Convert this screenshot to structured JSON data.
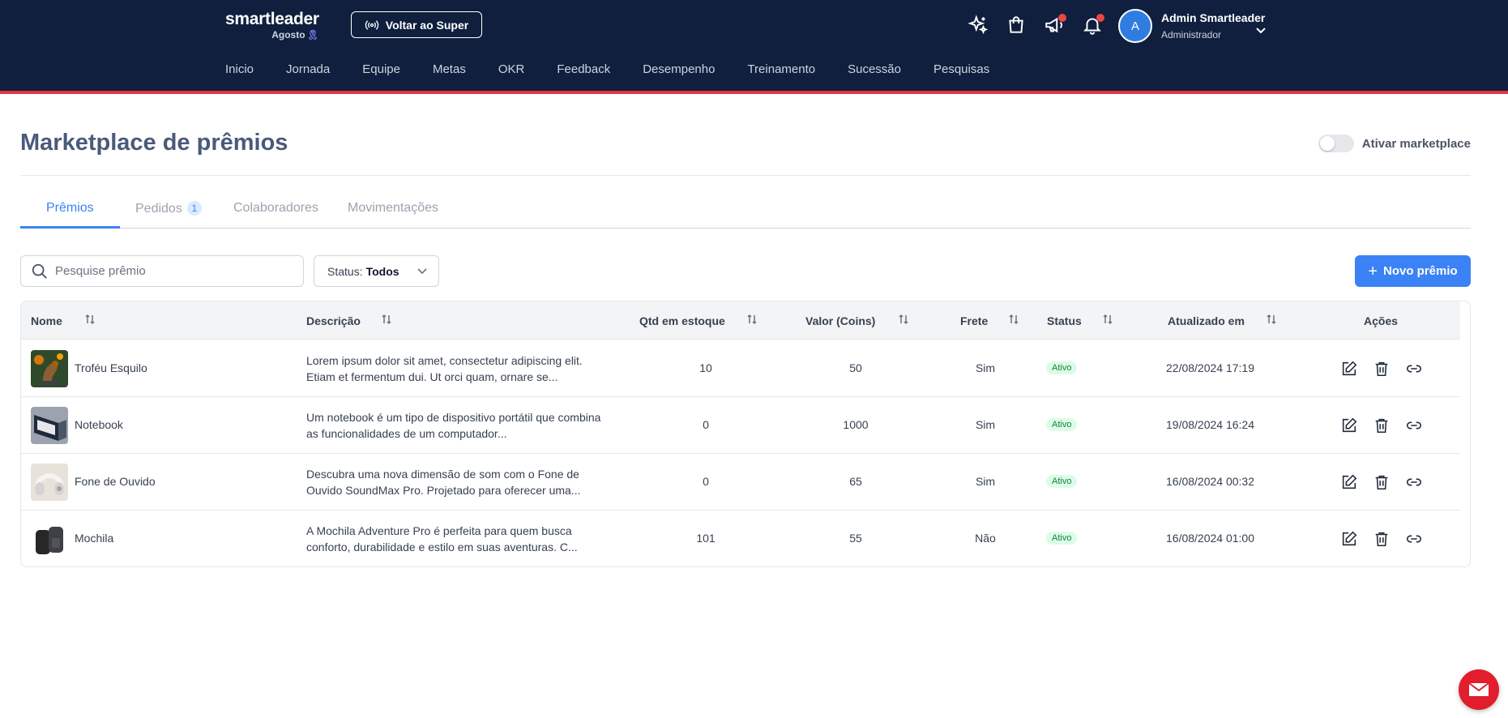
{
  "header": {
    "logo_name": "smartleader",
    "logo_sub": "Agosto",
    "back_button": "Voltar ao Super",
    "user_initial": "A",
    "user_name": "Admin Smartleader",
    "user_role": "Administrador",
    "icons": [
      "sparkles-icon",
      "shopping-bag-icon",
      "megaphone-icon",
      "bell-icon"
    ]
  },
  "nav": [
    "Inicio",
    "Jornada",
    "Equipe",
    "Metas",
    "OKR",
    "Feedback",
    "Desempenho",
    "Treinamento",
    "Sucessão",
    "Pesquisas"
  ],
  "page": {
    "title": "Marketplace de prêmios",
    "toggle_label": "Ativar marketplace"
  },
  "tabs": [
    {
      "label": "Prêmios"
    },
    {
      "label": "Pedidos",
      "count": "1"
    },
    {
      "label": "Colaboradores"
    },
    {
      "label": "Movimentações"
    }
  ],
  "filters": {
    "search_placeholder": "Pesquise prêmio",
    "status_label": "Status:",
    "status_value": "Todos",
    "new_button": "Novo prêmio"
  },
  "table": {
    "columns": [
      "Nome",
      "Descrição",
      "Qtd em estoque",
      "Valor (Coins)",
      "Frete",
      "Status",
      "Atualizado em",
      "Ações"
    ],
    "rows": [
      {
        "name": "Troféu Esquilo",
        "desc": "Lorem ipsum dolor sit amet, consectetur adipiscing elit. Etiam et fermentum dui. Ut orci quam, ornare se...",
        "stock": "10",
        "value": "50",
        "frete": "Sim",
        "status": "Ativo",
        "updated": "22/08/2024 17:19"
      },
      {
        "name": "Notebook",
        "desc": "Um notebook é um tipo de dispositivo portátil que combina as funcionalidades de um computador...",
        "stock": "0",
        "value": "1000",
        "frete": "Sim",
        "status": "Ativo",
        "updated": "19/08/2024 16:24"
      },
      {
        "name": "Fone de Ouvido",
        "desc": "Descubra uma nova dimensão de som com o Fone de Ouvido SoundMax Pro. Projetado para oferecer uma...",
        "stock": "0",
        "value": "65",
        "frete": "Sim",
        "status": "Ativo",
        "updated": "16/08/2024 00:32"
      },
      {
        "name": "Mochila",
        "desc": "A Mochila Adventure Pro é perfeita para quem busca conforto, durabilidade e estilo em suas aventuras. C...",
        "stock": "101",
        "value": "55",
        "frete": "Não",
        "status": "Ativo",
        "updated": "16/08/2024 01:00"
      }
    ]
  },
  "colors": {
    "topbar": "#0f1f3d",
    "accent": "#3b82f6",
    "alert": "#e03a4a"
  }
}
